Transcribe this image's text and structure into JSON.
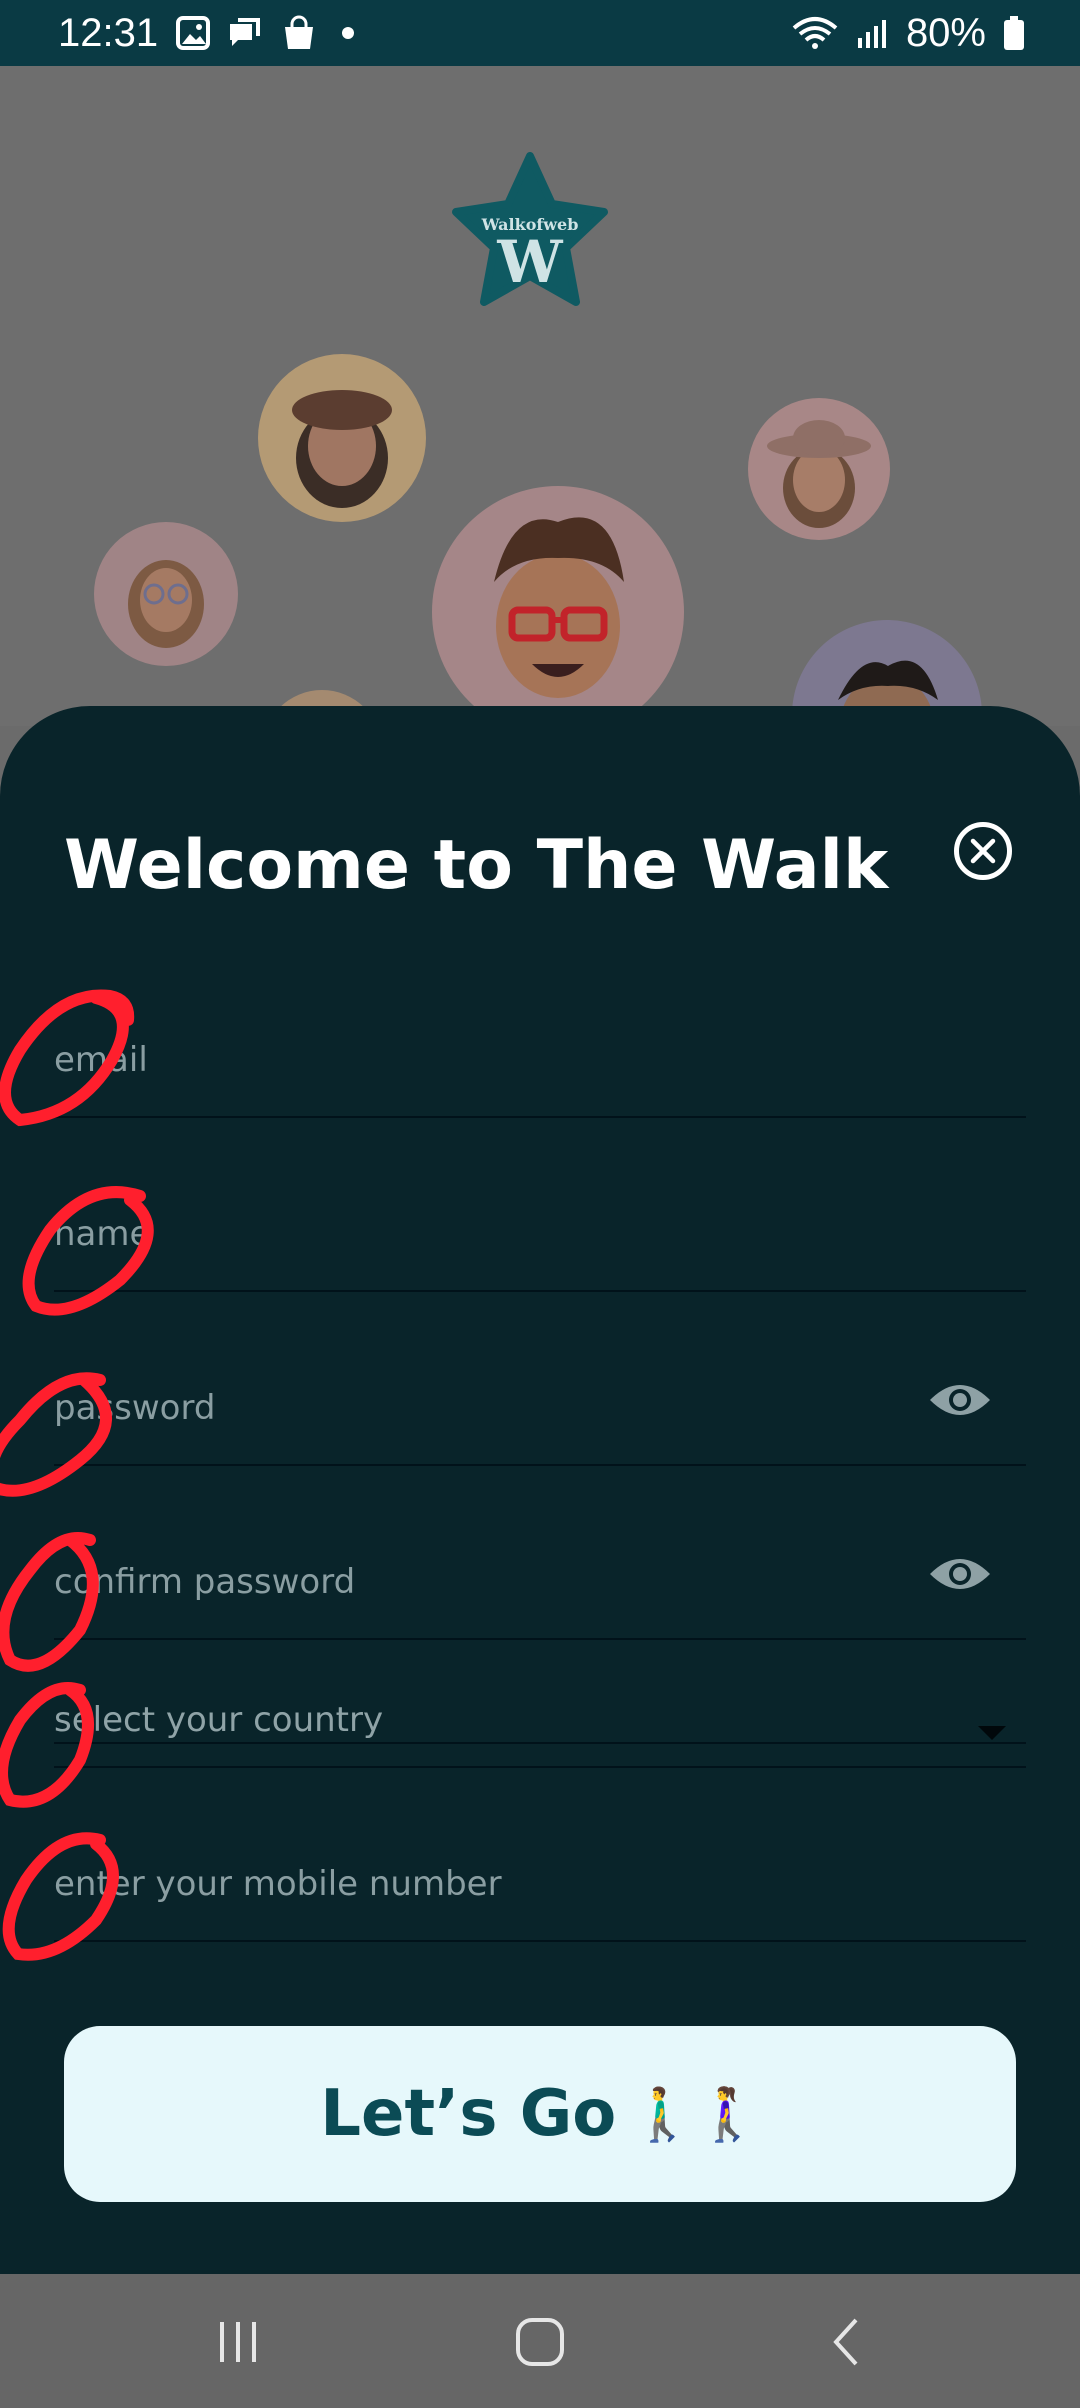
{
  "status_bar": {
    "time": "12:31",
    "battery": "80%",
    "left_icons": [
      "gallery-icon",
      "chat-icon",
      "shopping-bag-icon",
      "dot-icon"
    ],
    "right_icons": [
      "wifi-icon",
      "signal-icon",
      "battery-icon"
    ]
  },
  "logo": {
    "text": "Walkofweb",
    "letter": "W",
    "color": "#0f5a62"
  },
  "sheet": {
    "title": "Welcome to The Walk",
    "fields": {
      "email": {
        "placeholder": "email",
        "value": ""
      },
      "name": {
        "placeholder": "name",
        "value": ""
      },
      "password": {
        "placeholder": "password",
        "value": ""
      },
      "confirm_password": {
        "placeholder": "confirm password",
        "value": ""
      },
      "country": {
        "placeholder": "select your country",
        "value": "select your country"
      },
      "mobile": {
        "placeholder": "enter your mobile number",
        "value": ""
      }
    },
    "cta_label": "Let’s Go",
    "cta_emojis": "🚶‍♂️🚶‍♀️"
  },
  "colors": {
    "sheet_bg": "#09242a",
    "cta_bg": "#e6f8fb",
    "cta_text": "#0b4b55",
    "status_bar_bg": "#0a3a44",
    "annotation": "#ff1f2d"
  },
  "nav_bar": {
    "buttons": [
      "recent-apps-icon",
      "home-icon",
      "back-icon"
    ]
  }
}
